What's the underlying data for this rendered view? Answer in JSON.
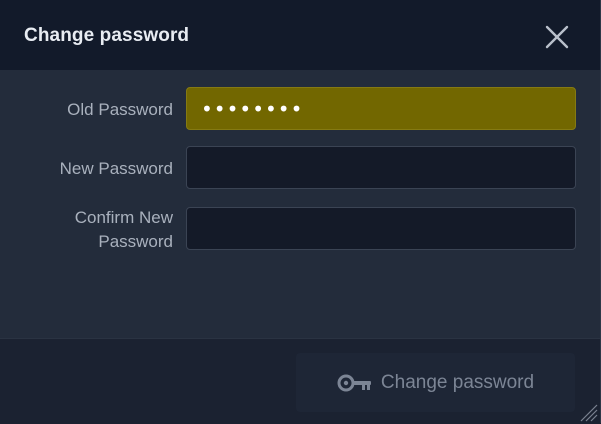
{
  "dialog": {
    "title": "Change password",
    "close_icon": "close-icon"
  },
  "form": {
    "old_password": {
      "label": "Old Password",
      "value": "••••••••"
    },
    "new_password": {
      "label": "New Password",
      "value": ""
    },
    "confirm_password": {
      "label_line1": "Confirm New",
      "label_line2": "Password",
      "value": ""
    }
  },
  "footer": {
    "submit_label": "Change password",
    "submit_icon": "key-icon"
  },
  "colors": {
    "autofill_background": "#726700",
    "titlebar": "#121a2a",
    "body": "#232c3b"
  }
}
